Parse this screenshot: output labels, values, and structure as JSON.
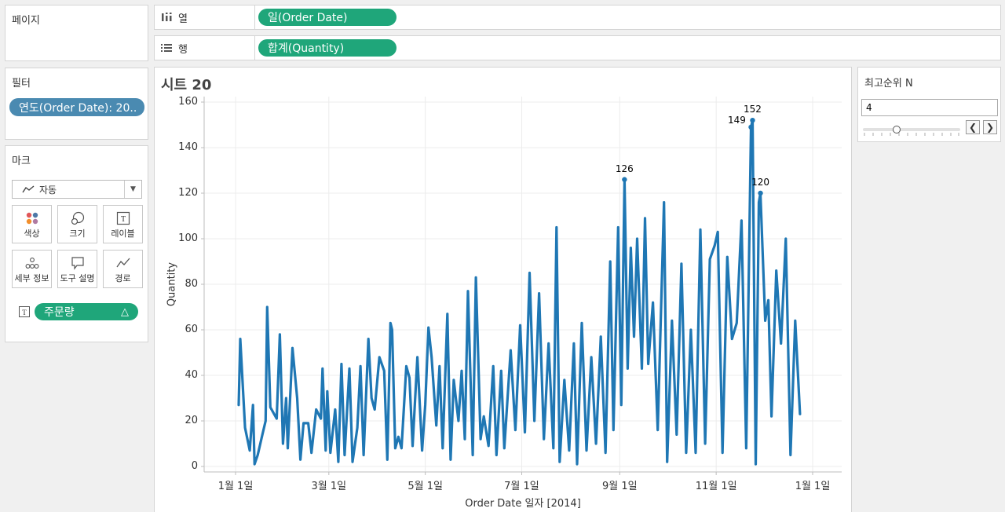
{
  "pages_panel": {
    "title": "페이지"
  },
  "columns_shelf": {
    "label": "열",
    "pill": "일(Order Date)"
  },
  "rows_shelf": {
    "label": "행",
    "pill": "합계(Quantity)"
  },
  "filters_panel": {
    "title": "필터",
    "pill": "연도(Order Date): 20.."
  },
  "marks_panel": {
    "title": "마크",
    "mark_type": "자동",
    "buttons": [
      "색상",
      "크기",
      "레이블",
      "세부 정보",
      "도구 설명",
      "경로"
    ],
    "label_pill": "주문량",
    "label_pill_icon": "delta-icon"
  },
  "parameter_panel": {
    "title": "최고순위 N",
    "value": "4",
    "slider_value": 4
  },
  "sheet": {
    "title": "시트 20"
  },
  "colors": {
    "line": "#1f77b4",
    "pill_green": "#1fa67a",
    "pill_blue": "#4a8ab1"
  },
  "chart_data": {
    "type": "line",
    "xlabel": "Order Date 일자 [2014]",
    "ylabel": "Quantity",
    "xlim": [
      "2014-01-01",
      "2015-01-01"
    ],
    "ylim": [
      0,
      160
    ],
    "yticks": [
      0,
      20,
      40,
      60,
      80,
      100,
      120,
      140,
      160
    ],
    "xticks": [
      {
        "date": "2014-01-01",
        "label": "1월 1일"
      },
      {
        "date": "2014-03-01",
        "label": "3월 1일"
      },
      {
        "date": "2014-05-01",
        "label": "5월 1일"
      },
      {
        "date": "2014-07-01",
        "label": "7월 1일"
      },
      {
        "date": "2014-09-01",
        "label": "9월 1일"
      },
      {
        "date": "2014-11-01",
        "label": "11월 1일"
      },
      {
        "date": "2015-01-01",
        "label": "1월 1일"
      }
    ],
    "grid": true,
    "series": [
      {
        "points": [
          [
            "2014-01-03",
            27
          ],
          [
            "2014-01-04",
            56
          ],
          [
            "2014-01-07",
            17
          ],
          [
            "2014-01-10",
            7
          ],
          [
            "2014-01-12",
            27
          ],
          [
            "2014-01-13",
            1
          ],
          [
            "2014-01-15",
            5
          ],
          [
            "2014-01-18",
            14
          ],
          [
            "2014-01-20",
            20
          ],
          [
            "2014-01-21",
            70
          ],
          [
            "2014-01-23",
            26
          ],
          [
            "2014-01-27",
            21
          ],
          [
            "2014-01-29",
            58
          ],
          [
            "2014-01-31",
            10
          ],
          [
            "2014-02-02",
            30
          ],
          [
            "2014-02-03",
            8
          ],
          [
            "2014-02-06",
            52
          ],
          [
            "2014-02-09",
            30
          ],
          [
            "2014-02-11",
            3
          ],
          [
            "2014-02-13",
            19
          ],
          [
            "2014-02-16",
            19
          ],
          [
            "2014-02-18",
            6
          ],
          [
            "2014-02-21",
            25
          ],
          [
            "2014-02-24",
            21
          ],
          [
            "2014-02-25",
            43
          ],
          [
            "2014-02-27",
            7
          ],
          [
            "2014-02-28",
            33
          ],
          [
            "2014-03-02",
            6
          ],
          [
            "2014-03-05",
            25
          ],
          [
            "2014-03-07",
            2
          ],
          [
            "2014-03-09",
            45
          ],
          [
            "2014-03-11",
            5
          ],
          [
            "2014-03-14",
            43
          ],
          [
            "2014-03-16",
            2
          ],
          [
            "2014-03-19",
            17
          ],
          [
            "2014-03-21",
            44
          ],
          [
            "2014-03-23",
            5
          ],
          [
            "2014-03-26",
            56
          ],
          [
            "2014-03-28",
            30
          ],
          [
            "2014-03-30",
            25
          ],
          [
            "2014-04-02",
            48
          ],
          [
            "2014-04-05",
            42
          ],
          [
            "2014-04-07",
            3
          ],
          [
            "2014-04-09",
            63
          ],
          [
            "2014-04-10",
            60
          ],
          [
            "2014-04-12",
            8
          ],
          [
            "2014-04-14",
            13
          ],
          [
            "2014-04-16",
            8
          ],
          [
            "2014-04-19",
            44
          ],
          [
            "2014-04-21",
            39
          ],
          [
            "2014-04-23",
            9
          ],
          [
            "2014-04-26",
            48
          ],
          [
            "2014-04-29",
            7
          ],
          [
            "2014-05-01",
            27
          ],
          [
            "2014-05-03",
            61
          ],
          [
            "2014-05-05",
            48
          ],
          [
            "2014-05-08",
            18
          ],
          [
            "2014-05-10",
            44
          ],
          [
            "2014-05-12",
            8
          ],
          [
            "2014-05-15",
            67
          ],
          [
            "2014-05-17",
            3
          ],
          [
            "2014-05-19",
            38
          ],
          [
            "2014-05-22",
            20
          ],
          [
            "2014-05-24",
            42
          ],
          [
            "2014-05-26",
            12
          ],
          [
            "2014-05-28",
            77
          ],
          [
            "2014-05-31",
            5
          ],
          [
            "2014-06-02",
            83
          ],
          [
            "2014-06-05",
            12
          ],
          [
            "2014-06-07",
            22
          ],
          [
            "2014-06-10",
            9
          ],
          [
            "2014-06-13",
            44
          ],
          [
            "2014-06-15",
            5
          ],
          [
            "2014-06-18",
            42
          ],
          [
            "2014-06-20",
            8
          ],
          [
            "2014-06-24",
            51
          ],
          [
            "2014-06-27",
            16
          ],
          [
            "2014-06-30",
            62
          ],
          [
            "2014-07-03",
            15
          ],
          [
            "2014-07-06",
            85
          ],
          [
            "2014-07-09",
            20
          ],
          [
            "2014-07-12",
            76
          ],
          [
            "2014-07-15",
            12
          ],
          [
            "2014-07-18",
            54
          ],
          [
            "2014-07-21",
            8
          ],
          [
            "2014-07-23",
            105
          ],
          [
            "2014-07-25",
            2
          ],
          [
            "2014-07-28",
            38
          ],
          [
            "2014-07-31",
            7
          ],
          [
            "2014-08-03",
            54
          ],
          [
            "2014-08-05",
            1
          ],
          [
            "2014-08-08",
            63
          ],
          [
            "2014-08-11",
            7
          ],
          [
            "2014-08-14",
            48
          ],
          [
            "2014-08-17",
            10
          ],
          [
            "2014-08-20",
            57
          ],
          [
            "2014-08-23",
            6
          ],
          [
            "2014-08-26",
            90
          ],
          [
            "2014-08-28",
            16
          ],
          [
            "2014-08-31",
            105
          ],
          [
            "2014-09-02",
            27
          ],
          [
            "2014-09-04",
            126
          ],
          [
            "2014-09-06",
            43
          ],
          [
            "2014-09-08",
            96
          ],
          [
            "2014-09-10",
            57
          ],
          [
            "2014-09-12",
            100
          ],
          [
            "2014-09-15",
            43
          ],
          [
            "2014-09-17",
            109
          ],
          [
            "2014-09-19",
            45
          ],
          [
            "2014-09-22",
            72
          ],
          [
            "2014-09-25",
            16
          ],
          [
            "2014-09-29",
            116
          ],
          [
            "2014-10-01",
            2
          ],
          [
            "2014-10-04",
            64
          ],
          [
            "2014-10-07",
            14
          ],
          [
            "2014-10-10",
            89
          ],
          [
            "2014-10-13",
            6
          ],
          [
            "2014-10-16",
            60
          ],
          [
            "2014-10-19",
            6
          ],
          [
            "2014-10-22",
            104
          ],
          [
            "2014-10-25",
            10
          ],
          [
            "2014-10-28",
            91
          ],
          [
            "2014-10-31",
            97
          ],
          [
            "2014-11-02",
            103
          ],
          [
            "2014-11-05",
            6
          ],
          [
            "2014-11-08",
            92
          ],
          [
            "2014-11-11",
            56
          ],
          [
            "2014-11-14",
            63
          ],
          [
            "2014-11-17",
            108
          ],
          [
            "2014-11-20",
            8
          ],
          [
            "2014-11-23",
            149
          ],
          [
            "2014-11-24",
            152
          ],
          [
            "2014-11-26",
            1
          ],
          [
            "2014-11-28",
            116
          ],
          [
            "2014-11-29",
            120
          ],
          [
            "2014-12-02",
            64
          ],
          [
            "2014-12-04",
            73
          ],
          [
            "2014-12-06",
            22
          ],
          [
            "2014-12-09",
            86
          ],
          [
            "2014-12-12",
            54
          ],
          [
            "2014-12-15",
            100
          ],
          [
            "2014-12-18",
            5
          ],
          [
            "2014-12-21",
            64
          ],
          [
            "2014-12-24",
            23
          ]
        ]
      }
    ],
    "labeled_points": [
      {
        "date": "2014-09-04",
        "value": 126,
        "label": "126"
      },
      {
        "date": "2014-11-23",
        "value": 149,
        "label": "149"
      },
      {
        "date": "2014-11-24",
        "value": 152,
        "label": "152"
      },
      {
        "date": "2014-11-29",
        "value": 120,
        "label": "120"
      }
    ]
  }
}
